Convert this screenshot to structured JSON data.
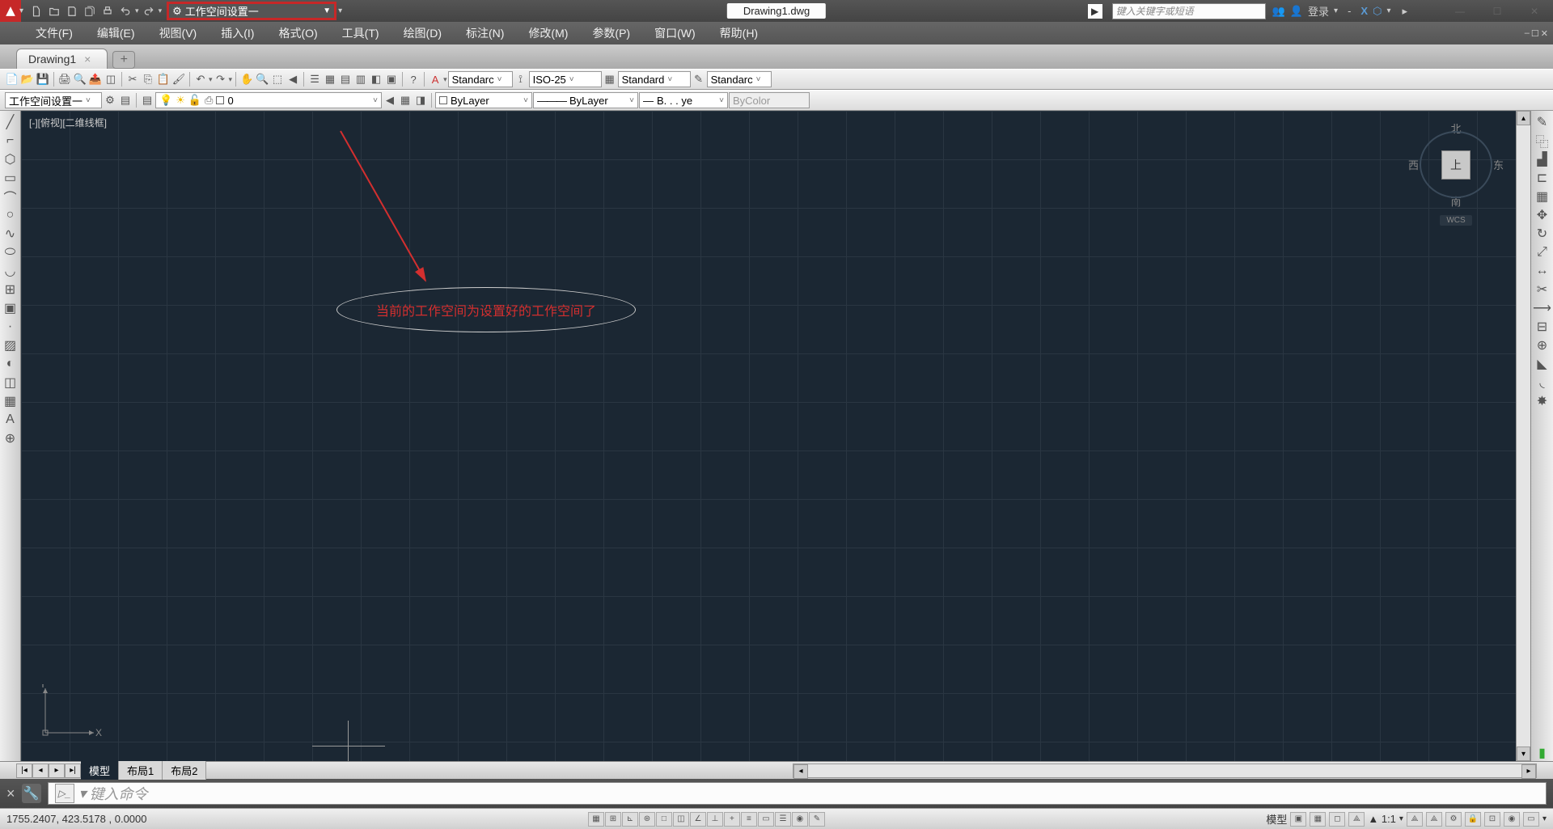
{
  "titlebar": {
    "workspace_label": "工作空间设置一",
    "document_title": "Drawing1.dwg",
    "search_placeholder": "键入关键字或短语",
    "login_label": "登录"
  },
  "menubar": {
    "items": [
      "文件(F)",
      "编辑(E)",
      "视图(V)",
      "插入(I)",
      "格式(O)",
      "工具(T)",
      "绘图(D)",
      "标注(N)",
      "修改(M)",
      "参数(P)",
      "窗口(W)",
      "帮助(H)"
    ]
  },
  "doc_tab": {
    "name": "Drawing1"
  },
  "toolbar2": {
    "workspace": "工作空间设置一",
    "layer": "0",
    "color": "ByLayer",
    "linetype": "ByLayer",
    "lineweight": "B. . . ye",
    "plotstyle": "ByColor",
    "textstyle": "Standarc",
    "dimstyle": "ISO-25",
    "tablestyle": "Standard",
    "mleaderstyle": "Standarc"
  },
  "drawing": {
    "viewport_label": "[-][俯视][二维线框]",
    "annotation_text": "当前的工作空间为设置好的工作空间了",
    "viewcube": {
      "north": "北",
      "south": "南",
      "east": "东",
      "west": "西",
      "top": "上",
      "wcs": "WCS"
    },
    "ucs": {
      "x": "X",
      "y": "Y"
    }
  },
  "layout_tabs": {
    "model": "模型",
    "layout1": "布局1",
    "layout2": "布局2"
  },
  "commandline": {
    "placeholder": "键入命令"
  },
  "statusbar": {
    "coords": "1755.2407, 423.5178 , 0.0000",
    "model_label": "模型",
    "scale": "▲ 1:1",
    "ratio": "▲"
  }
}
